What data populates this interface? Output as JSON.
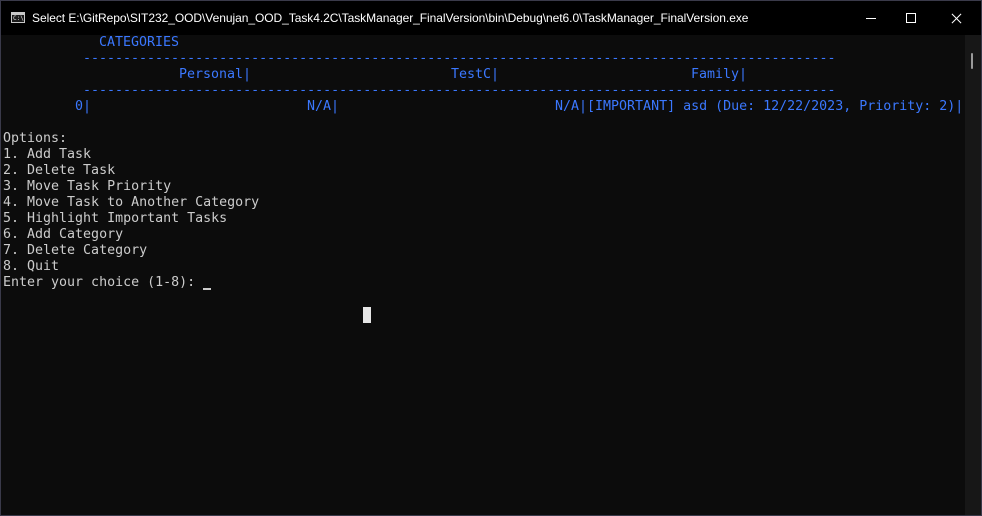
{
  "window": {
    "title": "Select E:\\GitRepo\\SIT232_OOD\\Venujan_OOD_Task4.2C\\TaskManager_FinalVersion\\bin\\Debug\\net6.0\\TaskManager_FinalVersion.exe",
    "app_icon_text": "C:\\"
  },
  "console": {
    "categories_heading": "CATEGORIES",
    "separator": "----------------------------------------------------------------------------------------------------",
    "headers": [
      "Personal|",
      "TestC|",
      "Family|"
    ],
    "row": {
      "index": "0|",
      "cells": [
        "N/A|",
        "N/A|[IMPORTANT] asd (Due: 12/22/2023, Priority: 2)|"
      ]
    },
    "options_label": "Options:",
    "options": [
      "1. Add Task",
      "2. Delete Task",
      "3. Move Task Priority",
      "4. Move Task to Another Category",
      "5. Highlight Important Tasks",
      "6. Add Category",
      "7. Delete Category",
      "8. Quit"
    ],
    "prompt": "Enter your choice (1-8): "
  },
  "colors": {
    "background": "#0c0c0c",
    "text": "#cccccc",
    "accent_blue": "#3b78ff"
  }
}
